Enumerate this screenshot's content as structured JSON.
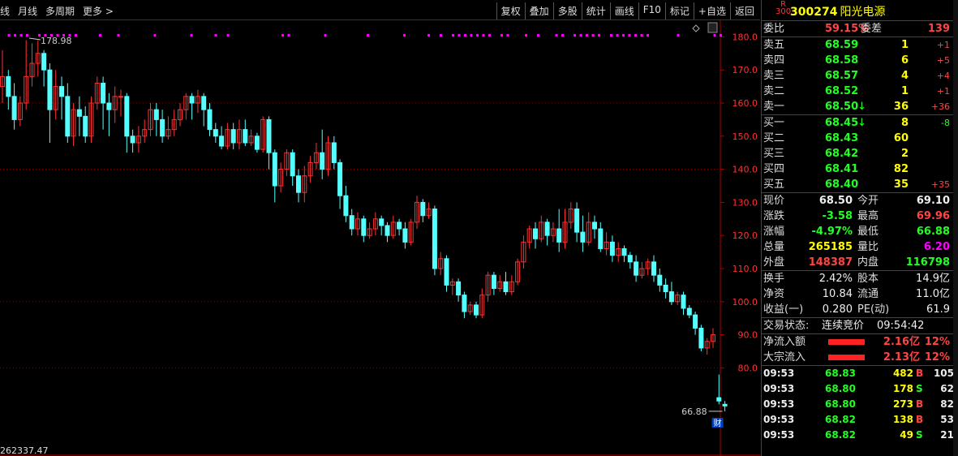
{
  "toolbar": {
    "left": [
      "线",
      "月线",
      "多周期",
      "更多 >"
    ],
    "right": [
      "复权",
      "叠加",
      "多股",
      "统计",
      "画线",
      "F10",
      "标记",
      "+自选",
      "返回"
    ]
  },
  "stock": {
    "badge_r": "R",
    "badge_num": "300",
    "code": "300274",
    "name": "阳光电源"
  },
  "weibi": {
    "label1": "委比",
    "pct": "59.15%",
    "label2": "委差",
    "diff": "139"
  },
  "sell": [
    {
      "label": "卖五",
      "price": "68.59",
      "vol": "1",
      "chg": "+1"
    },
    {
      "label": "卖四",
      "price": "68.58",
      "vol": "6",
      "chg": "+5"
    },
    {
      "label": "卖三",
      "price": "68.57",
      "vol": "4",
      "chg": "+4"
    },
    {
      "label": "卖二",
      "price": "68.52",
      "vol": "1",
      "chg": "+1"
    },
    {
      "label": "卖一",
      "price": "68.50",
      "arrow": "↓",
      "vol": "36",
      "chg": "+36"
    }
  ],
  "buy": [
    {
      "label": "买一",
      "price": "68.45",
      "arrow": "↓",
      "vol": "8",
      "chg": "-8"
    },
    {
      "label": "买二",
      "price": "68.43",
      "vol": "60",
      "chg": ""
    },
    {
      "label": "买三",
      "price": "68.42",
      "vol": "2",
      "chg": ""
    },
    {
      "label": "买四",
      "price": "68.41",
      "vol": "82",
      "chg": ""
    },
    {
      "label": "买五",
      "price": "68.40",
      "vol": "35",
      "chg": "+35"
    }
  ],
  "quote": [
    {
      "l1": "现价",
      "v1": "68.50",
      "l2": "今开",
      "v2": "69.10"
    },
    {
      "l1": "涨跌",
      "v1": "-3.58",
      "l2": "最高",
      "v2": "69.96"
    },
    {
      "l1": "涨幅",
      "v1": "-4.97%",
      "l2": "最低",
      "v2": "66.88"
    },
    {
      "l1": "总量",
      "v1": "265185",
      "l2": "量比",
      "v2": "6.20"
    },
    {
      "l1": "外盘",
      "v1": "148387",
      "l2": "内盘",
      "v2": "116798"
    }
  ],
  "fund": [
    {
      "l1": "换手",
      "v1": "2.42%",
      "l2": "股本",
      "v2": "14.9亿"
    },
    {
      "l1": "净资",
      "v1": "10.84",
      "l2": "流通",
      "v2": "11.0亿"
    },
    {
      "l1": "收益(一)",
      "v1": "0.280",
      "l2": "PE(动)",
      "v2": "61.9"
    }
  ],
  "status": {
    "label": "交易状态:",
    "value": "连续竞价",
    "time": "09:54:42"
  },
  "flows": [
    {
      "label": "净流入额",
      "value": "2.16亿",
      "pct": "12%"
    },
    {
      "label": "大宗流入",
      "value": "2.13亿",
      "pct": "12%"
    }
  ],
  "trades": [
    {
      "time": "09:53",
      "price": "68.83",
      "vol": "482",
      "side": "B",
      "n": "105"
    },
    {
      "time": "09:53",
      "price": "68.80",
      "vol": "178",
      "side": "S",
      "n": "62"
    },
    {
      "time": "09:53",
      "price": "68.80",
      "vol": "273",
      "side": "B",
      "n": "82"
    },
    {
      "time": "09:53",
      "price": "68.82",
      "vol": "138",
      "side": "B",
      "n": "53"
    },
    {
      "time": "09:53",
      "price": "68.82",
      "vol": "49",
      "side": "S",
      "n": "21"
    }
  ],
  "chart_data": {
    "type": "candlestick",
    "y_ticks": [
      "180.0",
      "170.0",
      "160.0",
      "150.0",
      "140.0",
      "130.0",
      "120.0",
      "110.0",
      "100.0",
      "90.0",
      "80.0"
    ],
    "ylim": [
      60,
      185
    ],
    "high_marker": "178.98",
    "low_marker": "66.88",
    "bottom_value": "262337.47",
    "cai_label": "财",
    "grid_lines": [
      160,
      140,
      100,
      80
    ],
    "up_color": "#ff3232",
    "down_color": "#54ffff",
    "candles": [
      [
        165,
        168,
        160,
        176
      ],
      [
        168,
        162,
        158,
        170
      ],
      [
        162,
        155,
        152,
        166
      ],
      [
        155,
        160,
        153,
        162
      ],
      [
        160,
        168,
        158,
        179
      ],
      [
        168,
        172,
        165,
        178
      ],
      [
        172,
        175,
        168,
        179
      ],
      [
        175,
        170,
        165,
        176
      ],
      [
        170,
        158,
        148,
        172
      ],
      [
        158,
        165,
        155,
        170
      ],
      [
        165,
        162,
        155,
        168
      ],
      [
        162,
        150,
        148,
        166
      ],
      [
        150,
        158,
        147,
        160
      ],
      [
        158,
        156,
        150,
        162
      ],
      [
        156,
        150,
        148,
        159
      ],
      [
        150,
        160,
        148,
        162
      ],
      [
        160,
        166,
        158,
        168
      ],
      [
        166,
        160,
        152,
        168
      ],
      [
        160,
        158,
        150,
        163
      ],
      [
        158,
        162,
        154,
        165
      ],
      [
        162,
        162,
        156,
        164
      ],
      [
        162,
        150,
        145,
        163
      ],
      [
        150,
        148,
        145,
        152
      ],
      [
        148,
        150,
        145,
        153
      ],
      [
        150,
        152,
        148,
        155
      ],
      [
        152,
        158,
        150,
        160
      ],
      [
        158,
        155,
        150,
        160
      ],
      [
        155,
        150,
        148,
        158
      ],
      [
        150,
        152,
        149,
        156
      ],
      [
        152,
        155,
        150,
        158
      ],
      [
        155,
        158,
        153,
        160
      ],
      [
        158,
        162,
        155,
        163
      ],
      [
        162,
        160,
        155,
        163
      ],
      [
        160,
        162,
        157,
        164
      ],
      [
        162,
        158,
        153,
        163
      ],
      [
        158,
        152,
        150,
        160
      ],
      [
        152,
        150,
        148,
        154
      ],
      [
        150,
        147,
        146,
        153
      ],
      [
        147,
        152,
        146,
        154
      ],
      [
        152,
        148,
        146,
        154
      ],
      [
        148,
        152,
        146,
        155
      ],
      [
        152,
        148,
        147,
        155
      ],
      [
        148,
        150,
        147,
        152
      ],
      [
        150,
        146,
        145,
        151
      ],
      [
        146,
        155,
        145,
        156
      ],
      [
        155,
        145,
        140,
        156
      ],
      [
        145,
        135,
        130,
        146
      ],
      [
        135,
        140,
        133,
        142
      ],
      [
        140,
        145,
        138,
        146
      ],
      [
        145,
        138,
        135,
        146
      ],
      [
        138,
        133,
        130,
        140
      ],
      [
        133,
        138,
        130,
        141
      ],
      [
        138,
        142,
        136,
        144
      ],
      [
        142,
        145,
        140,
        148
      ],
      [
        145,
        140,
        137,
        152
      ],
      [
        140,
        148,
        138,
        150
      ],
      [
        148,
        142,
        140,
        150
      ],
      [
        142,
        132,
        128,
        143
      ],
      [
        132,
        126,
        124,
        135
      ],
      [
        126,
        122,
        120,
        128
      ],
      [
        122,
        125,
        120,
        127
      ],
      [
        125,
        120,
        118,
        126
      ],
      [
        120,
        122,
        119,
        124
      ],
      [
        122,
        125,
        120,
        127
      ],
      [
        125,
        123,
        120,
        126
      ],
      [
        123,
        120,
        118,
        124
      ],
      [
        120,
        124,
        119,
        126
      ],
      [
        124,
        122,
        120,
        125
      ],
      [
        122,
        118,
        116,
        124
      ],
      [
        118,
        124,
        117,
        125
      ],
      [
        124,
        130,
        122,
        132
      ],
      [
        130,
        126,
        124,
        131
      ],
      [
        126,
        128,
        125,
        130
      ],
      [
        128,
        110,
        108,
        129
      ],
      [
        110,
        113,
        108,
        115
      ],
      [
        113,
        105,
        103,
        114
      ],
      [
        105,
        106,
        102,
        107
      ],
      [
        106,
        102,
        100,
        107
      ],
      [
        102,
        97,
        95,
        103
      ],
      [
        97,
        99,
        96,
        100
      ],
      [
        99,
        96,
        95,
        100
      ],
      [
        96,
        102,
        95,
        104
      ],
      [
        102,
        108,
        100,
        109
      ],
      [
        108,
        104,
        102,
        109
      ],
      [
        104,
        106,
        103,
        108
      ],
      [
        106,
        103,
        102,
        109
      ],
      [
        103,
        106,
        102,
        108
      ],
      [
        106,
        112,
        105,
        113
      ],
      [
        112,
        118,
        110,
        120
      ],
      [
        118,
        122,
        116,
        123
      ],
      [
        122,
        119,
        116,
        124
      ],
      [
        119,
        124,
        118,
        126
      ],
      [
        124,
        120,
        117,
        125
      ],
      [
        120,
        122,
        118,
        124
      ],
      [
        122,
        118,
        115,
        128
      ],
      [
        118,
        124,
        116,
        128
      ],
      [
        124,
        128,
        122,
        130
      ],
      [
        128,
        121,
        118,
        130
      ],
      [
        121,
        118,
        115,
        126
      ],
      [
        118,
        124,
        117,
        127
      ],
      [
        124,
        122,
        119,
        126
      ],
      [
        122,
        116,
        115,
        124
      ],
      [
        116,
        118,
        114,
        121
      ],
      [
        118,
        114,
        112,
        120
      ],
      [
        114,
        116,
        112,
        118
      ],
      [
        116,
        114,
        112,
        117
      ],
      [
        114,
        112,
        110,
        115
      ],
      [
        112,
        108,
        106,
        114
      ],
      [
        108,
        110,
        107,
        112
      ],
      [
        110,
        112,
        108,
        113
      ],
      [
        112,
        108,
        106,
        114
      ],
      [
        108,
        105,
        103,
        110
      ],
      [
        105,
        103,
        101,
        107
      ],
      [
        103,
        100,
        99,
        106
      ],
      [
        100,
        102,
        99,
        103
      ],
      [
        102,
        98,
        96,
        103
      ],
      [
        98,
        96,
        95,
        99
      ],
      [
        96,
        92,
        90,
        97
      ],
      [
        92,
        86,
        85,
        93
      ],
      [
        86,
        88,
        84,
        89
      ],
      [
        88,
        90,
        86,
        92
      ],
      [
        71,
        70,
        69,
        78
      ],
      [
        69,
        68.5,
        66.88,
        70
      ]
    ]
  }
}
